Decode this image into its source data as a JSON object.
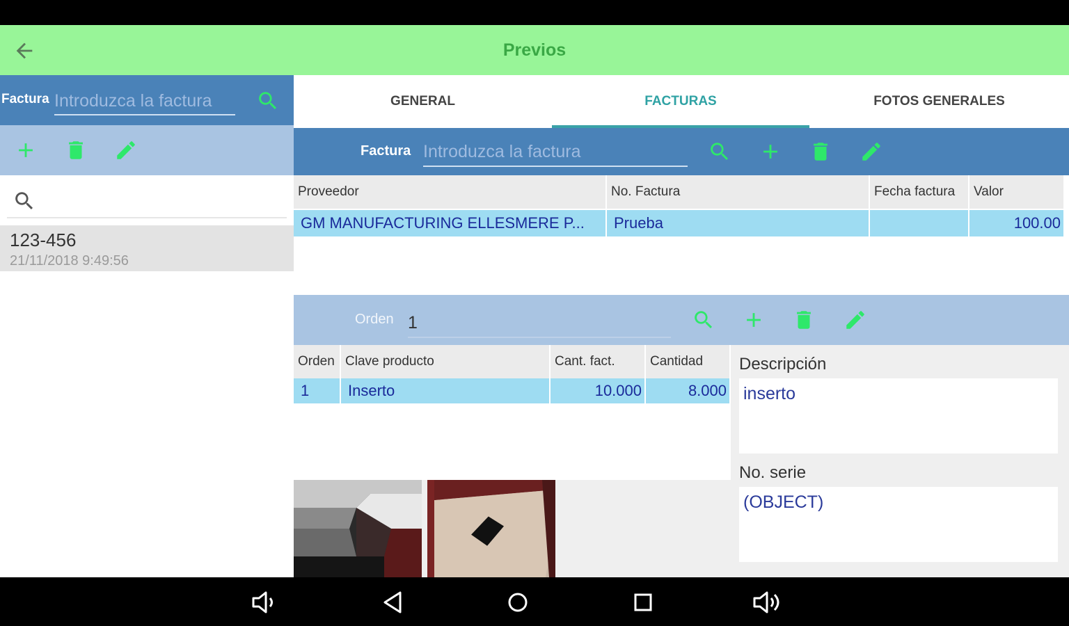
{
  "app_bar": {
    "title": "Previos",
    "back_icon": "arrow-back-icon"
  },
  "left": {
    "search_label": "Factura",
    "search_placeholder": "Introduzca la factura",
    "list": [
      {
        "code": "123-456",
        "date": "21/11/2018 9:49:56"
      }
    ]
  },
  "tabs": [
    "GENERAL",
    "FACTURAS",
    "FOTOS GENERALES"
  ],
  "active_tab": "FACTURAS",
  "facturas": {
    "label": "Factura",
    "placeholder": "Introduzca la factura",
    "columns": [
      "Proveedor",
      "No. Factura",
      "Fecha factura",
      "Valor"
    ],
    "rows": [
      [
        "GM MANUFACTURING ELLESMERE P...",
        "Prueba",
        "",
        "100.00"
      ]
    ]
  },
  "orden": {
    "label": "Orden",
    "value": "1",
    "columns": [
      "Orden",
      "Clave producto",
      "Cant. fact.",
      "Cantidad"
    ],
    "rows": [
      [
        "1",
        "Inserto",
        "10.000",
        "8.000"
      ]
    ],
    "descripcion_label": "Descripción",
    "descripcion": "inserto",
    "serie_label": "No. serie",
    "serie": "(OBJECT)"
  },
  "colors": {
    "app_bar": "#98f598",
    "primary_blue": "#4a82b8",
    "light_blue": "#a9c4e2",
    "selected_row": "#9edcf2",
    "accent_green": "#2ee86a",
    "tab_active": "#2fa2a4"
  }
}
